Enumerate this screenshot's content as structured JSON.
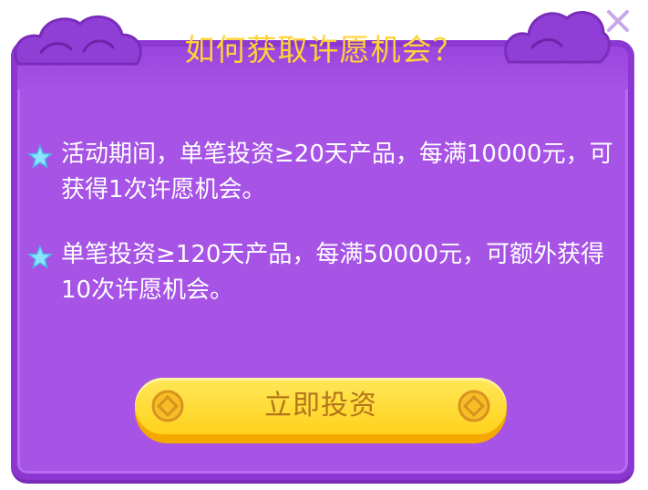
{
  "dialog": {
    "title": "如何获取许愿机会？",
    "close_icon": "close-icon",
    "rules": [
      {
        "icon": "star-icon",
        "text": "活动期间，单笔投资≥20天产品，每满10000元，可获得1次许愿机会。"
      },
      {
        "icon": "star-icon",
        "text": "单笔投资≥120天产品，每满50000元，可额外获得10次许愿机会。"
      }
    ],
    "cta_label": "立即投资"
  },
  "colors": {
    "panel": "#a653e6",
    "border": "#8c37d2",
    "title": "#ffd335",
    "button": "#ffd21c",
    "button_text": "#b4741b"
  }
}
